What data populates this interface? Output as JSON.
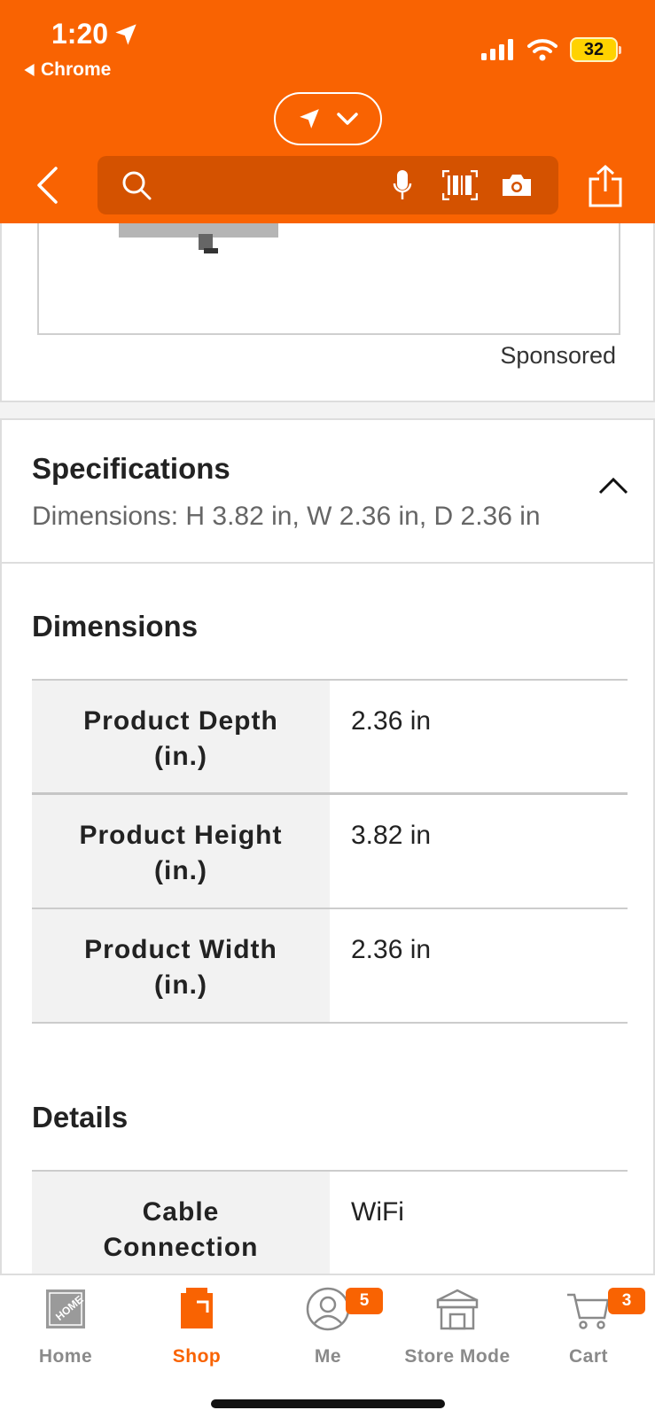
{
  "status_bar": {
    "time": "1:20",
    "back_app": "Chrome",
    "battery": "32"
  },
  "colors": {
    "brand_orange": "#f96302",
    "search_bg": "#d45200"
  },
  "header": {
    "icons": [
      "location-arrow-icon",
      "chevron-down-icon",
      "back-chevron-icon",
      "search-icon",
      "microphone-icon",
      "barcode-icon",
      "camera-icon",
      "share-icon"
    ]
  },
  "sponsored": {
    "label": "Sponsored"
  },
  "specifications": {
    "title": "Specifications",
    "summary": "Dimensions: H 3.82 in, W 2.36 in, D 2.36 in"
  },
  "dimensions": {
    "title": "Dimensions",
    "rows": [
      {
        "name_line1": "Product Depth",
        "name_line2": "(in.)",
        "value": "2.36 in"
      },
      {
        "name_line1": "Product Height",
        "name_line2": "(in.)",
        "value": "3.82 in"
      },
      {
        "name_line1": "Product Width",
        "name_line2": "(in.)",
        "value": "2.36 in"
      }
    ]
  },
  "details": {
    "title": "Details",
    "rows": [
      {
        "name_line1": "Cable",
        "name_line2": "Connection",
        "value": "WiFi"
      }
    ]
  },
  "tab_bar": {
    "tabs": [
      {
        "label": "Home",
        "icon": "home-depot-logo-icon"
      },
      {
        "label": "Shop",
        "icon": "shop-icon"
      },
      {
        "label": "Me",
        "icon": "user-icon",
        "badge": "5"
      },
      {
        "label": "Store Mode",
        "icon": "store-icon"
      },
      {
        "label": "Cart",
        "icon": "cart-icon",
        "badge": "3"
      }
    ]
  }
}
